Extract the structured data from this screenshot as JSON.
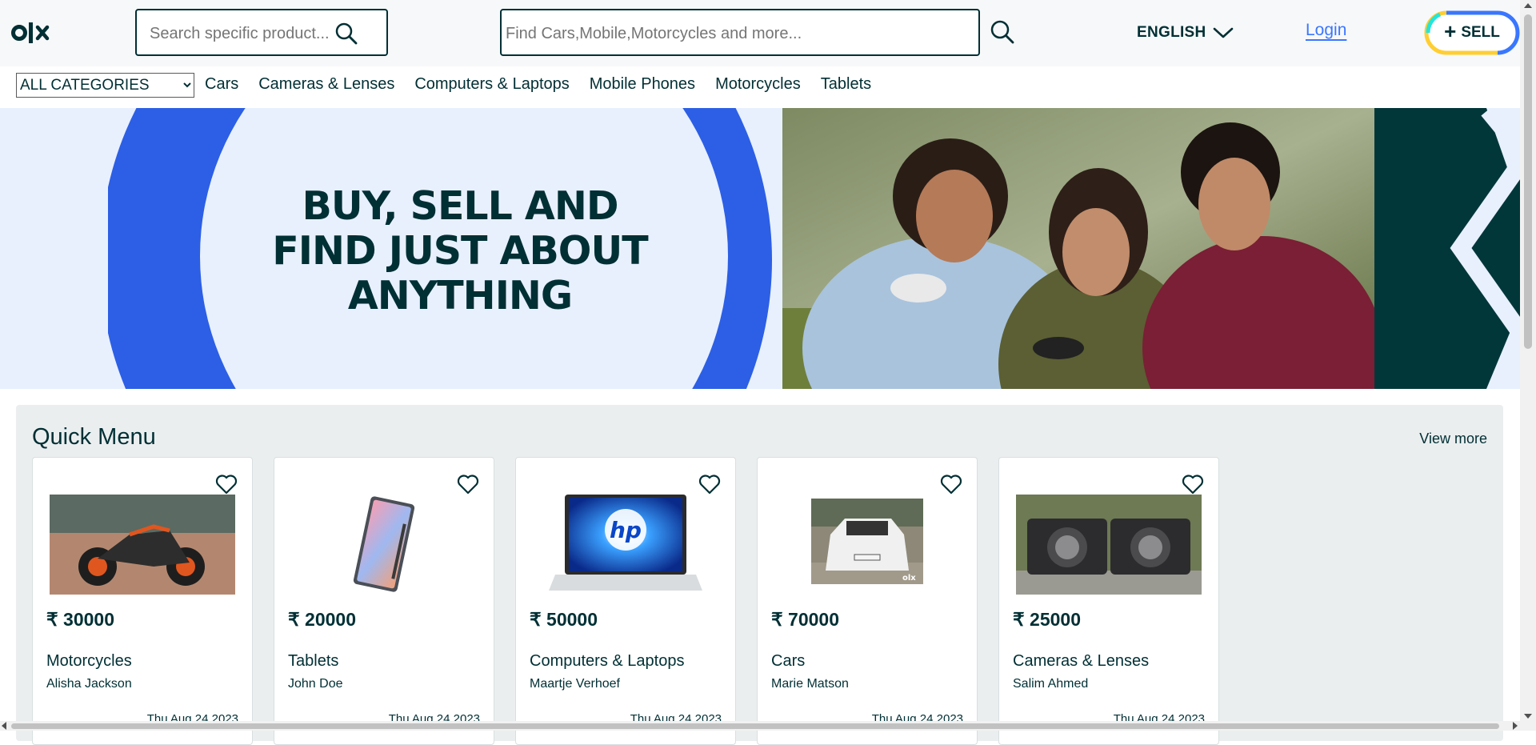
{
  "header": {
    "logo_icon": "olx-logo",
    "search_small": {
      "placeholder": "Search specific product..."
    },
    "search_main": {
      "placeholder": "Find Cars,Mobile,Motorcycles and more..."
    },
    "language": "ENGLISH",
    "login": "Login",
    "sell": "SELL"
  },
  "category_nav": {
    "select_value": "ALL CATEGORIES",
    "links": [
      "Cars",
      "Cameras & Lenses",
      "Computers & Laptops",
      "Mobile Phones",
      "Motorcycles",
      "Tablets"
    ]
  },
  "banner": {
    "line1": "BUY, SELL AND",
    "line2": "FIND JUST ABOUT",
    "line3": "ANYTHING",
    "colors": {
      "blue": "#2c5fe5",
      "light": "#e8f0fe",
      "dark": "#02373a"
    }
  },
  "quick_menu": {
    "title": "Quick Menu",
    "view_more": "View more",
    "cards": [
      {
        "price": "₹ 30000",
        "category": "Motorcycles",
        "seller": "Alisha Jackson",
        "date": "Thu Aug 24 2023",
        "image_icon": "motorcycle-photo"
      },
      {
        "price": "₹ 20000",
        "category": "Tablets",
        "seller": "John Doe",
        "date": "Thu Aug 24 2023",
        "image_icon": "tablet-photo"
      },
      {
        "price": "₹ 50000",
        "category": "Computers & Laptops",
        "seller": "Maartje Verhoef",
        "date": "Thu Aug 24 2023",
        "image_icon": "laptop-photo"
      },
      {
        "price": "₹ 70000",
        "category": "Cars",
        "seller": "Marie Matson",
        "date": "Thu Aug 24 2023",
        "image_icon": "car-photo"
      },
      {
        "price": "₹ 25000",
        "category": "Cameras & Lenses",
        "seller": "Salim Ahmed",
        "date": "Thu Aug 24 2023",
        "image_icon": "camera-photo"
      }
    ]
  }
}
